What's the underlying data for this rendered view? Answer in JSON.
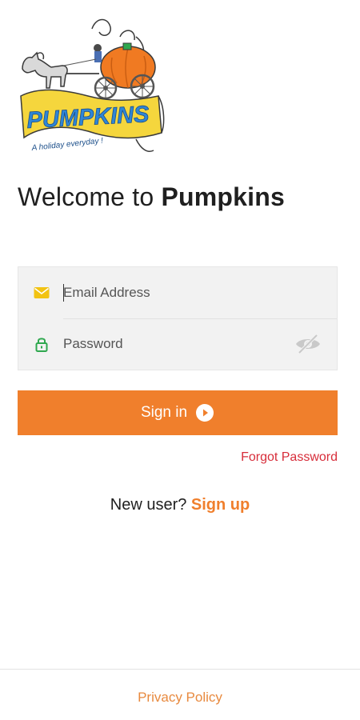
{
  "logo": {
    "brand_text": "PUMPKINS",
    "tagline": "A holiday everyday !"
  },
  "welcome": {
    "prefix": "Welcome to ",
    "brand": "Pumpkins"
  },
  "form": {
    "email": {
      "placeholder": "Email Address",
      "value": "",
      "icon": "mail-icon"
    },
    "password": {
      "placeholder": "Password",
      "value": "",
      "icon": "lock-icon",
      "toggle_icon": "eye-off-icon"
    }
  },
  "signin": {
    "label": "Sign in",
    "icon": "play-circle-icon"
  },
  "links": {
    "forgot_password": "Forgot Password",
    "new_user_prompt": "New user? ",
    "sign_up": "Sign up",
    "privacy_policy": "Privacy Policy"
  },
  "colors": {
    "accent": "#f07f2c",
    "forgot": "#d72d3a",
    "mail_icon": "#f2c313",
    "lock_icon": "#2fa84f",
    "logo_banner": "#f5d63d",
    "logo_text": "#2f86d6",
    "pumpkin": "#f07a22"
  }
}
